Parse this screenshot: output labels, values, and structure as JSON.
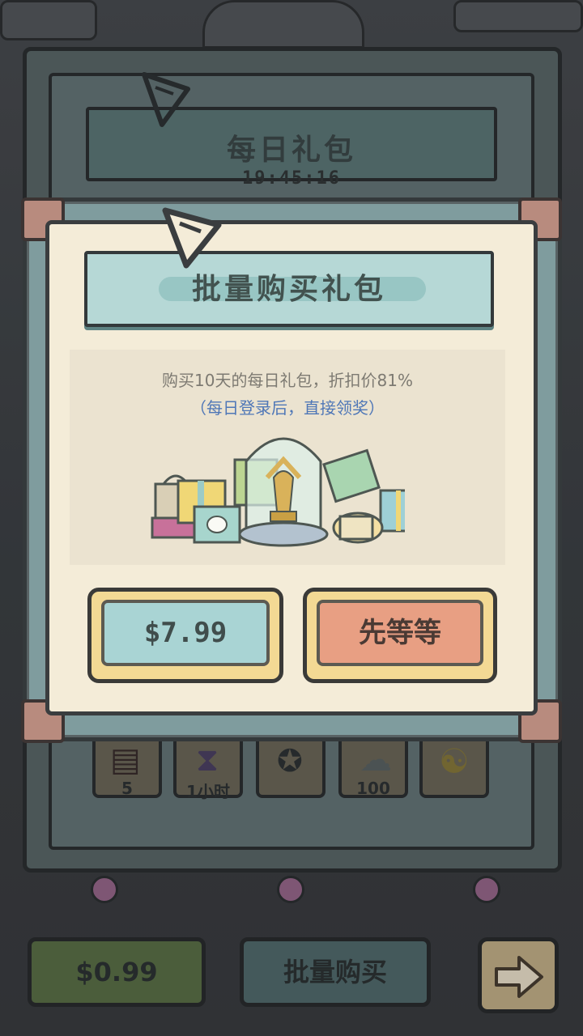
{
  "background": {
    "title": "每日礼包",
    "timer": "19:45:16",
    "items": [
      {
        "label": "5",
        "icon": "book-icon"
      },
      {
        "label": "1小时",
        "icon": "hourglass-icon"
      },
      {
        "label": "",
        "icon": "vault-icon"
      },
      {
        "label": "100",
        "icon": "ghost-icon"
      },
      {
        "label": "",
        "icon": "yin-yang-icon"
      }
    ],
    "price_button": "$0.99",
    "bulk_button": "批量购买",
    "next_icon": "arrow-right-icon"
  },
  "dialog": {
    "title": "批量购买礼包",
    "description": "购买10天的每日礼包，折扣价81%",
    "note": "（每日登录后，直接领奖）",
    "buy_button": "$7.99",
    "wait_button": "先等等",
    "illustration": "gift-pile-with-statue-in-glass-dome"
  },
  "colors": {
    "paper": "#f4ecd8",
    "title_bar": "#b6d8d6",
    "buy_face": "#a9d4d4",
    "wait_face": "#e89f83",
    "note_text": "#4f77b7"
  }
}
